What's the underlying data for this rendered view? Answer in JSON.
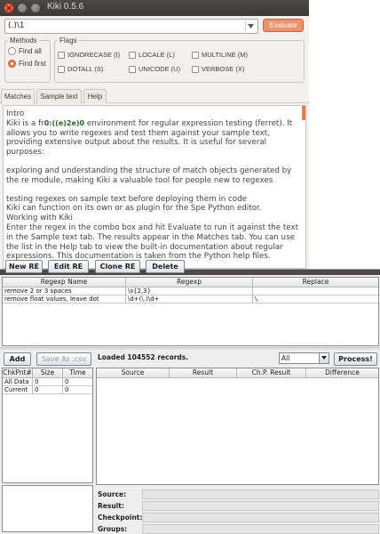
{
  "kiki": {
    "title": "Kiki 0.5.6",
    "regex_input": "(.)\\1",
    "evaluate_label": "Evaluate",
    "methods": {
      "title": "Methods",
      "options": [
        {
          "label": "Find all",
          "selected": false
        },
        {
          "label": "Find first",
          "selected": true
        }
      ]
    },
    "flags": {
      "title": "Flags",
      "items": [
        {
          "label": "IGNORECASE (I)",
          "checked": false
        },
        {
          "label": "LOCALE (L)",
          "checked": false
        },
        {
          "label": "MULTILINE (M)",
          "checked": false
        },
        {
          "label": "DOTALL (S)",
          "checked": false
        },
        {
          "label": "UNICODE (U)",
          "checked": false
        },
        {
          "label": "VERBOSE (X)",
          "checked": false
        }
      ]
    },
    "tabs": [
      {
        "label": "Matches",
        "active": true
      },
      {
        "label": "Sample text",
        "active": false
      },
      {
        "label": "Help",
        "active": false
      }
    ],
    "output": {
      "heading": "Intro",
      "line1_pre": "Kiki is a fr",
      "match_text": "0:((e)2e)0",
      "line1_post": " environment for regular expression testing (ferret). It allows you to write regexes and test them against your sample text, providing extensive output about the results. It is useful for several purposes:",
      "para2": "exploring and understanding the structure of match objects generated by the re module, making Kiki a valuable tool for people new to regexes",
      "para3": "testing regexes on sample text before deploying them in code",
      "para4": "Kiki can function on its own or as plugin for the Spe Python editor.",
      "para5": "Working with Kiki",
      "para6": "Enter the regex in the combo box and hit Evaluate to run it against the text in the Sample text tab. The results appear in the Matches tab. You can use the list in the Help tab to view the built-in documentation about regular",
      "para7": "expressions. This documentation is taken from the Python help files."
    },
    "accent_color": "#f07746"
  },
  "tester": {
    "toolbar": {
      "new_re": "New RE",
      "edit_re": "Edit RE",
      "clone_re": "Clone RE",
      "delete": "Delete"
    },
    "regex_table": {
      "headers": [
        "Regexp Name",
        "Regexp",
        "Replace"
      ],
      "rows": [
        [
          "remove 2 or 3 spaces",
          "\\s{2,3}",
          ""
        ],
        [
          "remove float values, leave dot",
          "\\d+(\\.)\\d+",
          "\\."
        ]
      ]
    },
    "add_label": "Add",
    "save_csv_label": "Save As .csv",
    "loaded_text": "Loaded 104552 records.",
    "filter_value": "All",
    "process_label": "Process!",
    "checkpoint_table": {
      "headers": [
        "ChkPnt#",
        "Size",
        "Time"
      ],
      "rows": [
        [
          "All Data",
          "0",
          "0"
        ],
        [
          "Current",
          "0",
          "0"
        ]
      ]
    },
    "results_table": {
      "headers": [
        "Source",
        "Result",
        "Ch.P. Result",
        "Difference"
      ]
    },
    "details": {
      "source_label": "Source:",
      "result_label": "Result:",
      "checkpoint_label": "Checkpoint:",
      "groups_label": "Groups:"
    }
  }
}
